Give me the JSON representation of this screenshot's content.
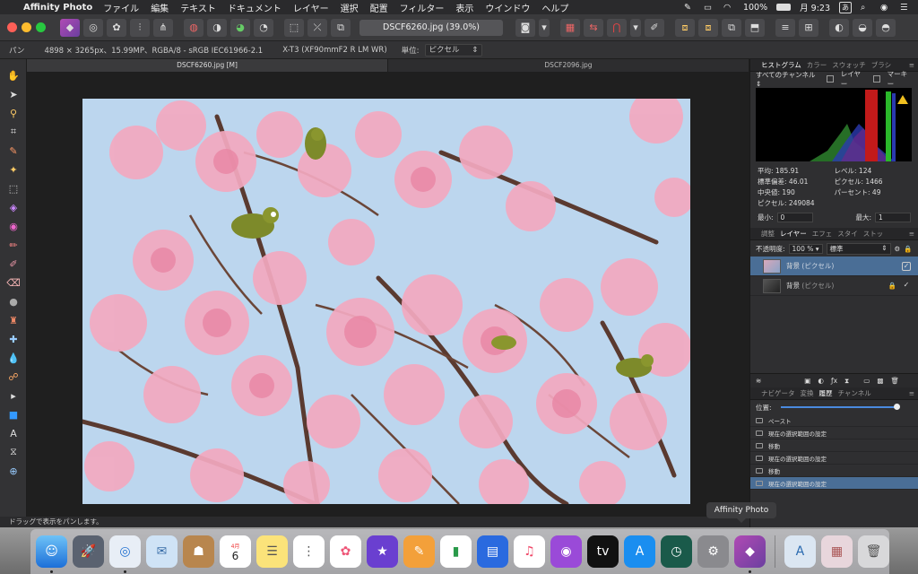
{
  "menubar": {
    "app_name": "Affinity Photo",
    "items": [
      "ファイル",
      "編集",
      "テキスト",
      "ドキュメント",
      "レイヤー",
      "選択",
      "配置",
      "フィルター",
      "表示",
      "ウインドウ",
      "ヘルプ"
    ],
    "battery": "100%",
    "clock": "月 9:23",
    "input_mode": "あ"
  },
  "toolbar": {
    "doc_title": "DSCF6260.jpg (39.0%)"
  },
  "context": {
    "tool": "パン",
    "info": "4898 × 3265px、15.99MP、RGBA/8 - sRGB IEC61966-2.1",
    "camera": "X-T3 (XF90mmF2 R LM WR)",
    "unit_label": "単位:",
    "unit_value": "ピクセル"
  },
  "tabs": [
    {
      "label": "DSCF6260.jpg [M]",
      "active": true
    },
    {
      "label": "DSCF2096.jpg",
      "active": false
    }
  ],
  "status": "ドラッグで表示をパンします。",
  "histogram_panel": {
    "tabs": [
      "ヒストグラム",
      "カラー",
      "スウォッチ",
      "ブラシ"
    ],
    "channel": "すべてのチャンネル",
    "layer_opt": "レイヤー",
    "marquee_opt": "マーキー",
    "stats": [
      {
        "k": "平均:",
        "v": "185.91"
      },
      {
        "k": "レベル:",
        "v": "124"
      },
      {
        "k": "標準偏差:",
        "v": "46.01"
      },
      {
        "k": "ピクセル:",
        "v": "1466"
      },
      {
        "k": "中央値:",
        "v": "190"
      },
      {
        "k": "パーセント:",
        "v": "49"
      },
      {
        "k": "ピクセル:",
        "v": "249084"
      }
    ],
    "min_label": "最小:",
    "min_value": "0",
    "max_label": "最大:",
    "max_value": "1"
  },
  "layers_panel": {
    "tabs": [
      "調整",
      "レイヤー",
      "エフェ",
      "スタイ",
      "ストッ"
    ],
    "opacity_label": "不透明度:",
    "opacity_value": "100 %",
    "blend": "標準",
    "layers": [
      {
        "name": "背景",
        "type": "(ピクセル)"
      },
      {
        "name": "背景",
        "type": "(ピクセル)"
      }
    ]
  },
  "history_panel": {
    "tabs": [
      "ナビゲータ",
      "変換",
      "履歴",
      "チャンネル"
    ],
    "position_label": "位置:",
    "items": [
      "ペースト",
      "現在の選択範囲の設定",
      "移動",
      "現在の選択範囲の設定",
      "移動",
      "現在の選択範囲の設定"
    ]
  },
  "dock": {
    "tooltip": "Affinity Photo",
    "calendar_month": "4月",
    "calendar_day": "6",
    "tv_label": "tv"
  },
  "colors": {
    "traffic_red": "#fe5f57",
    "traffic_yellow": "#febc2e",
    "traffic_green": "#28c840",
    "selected_layer": "#4a6e96",
    "sky": "#bcd6ee",
    "blossom": "#f3a9c0"
  }
}
